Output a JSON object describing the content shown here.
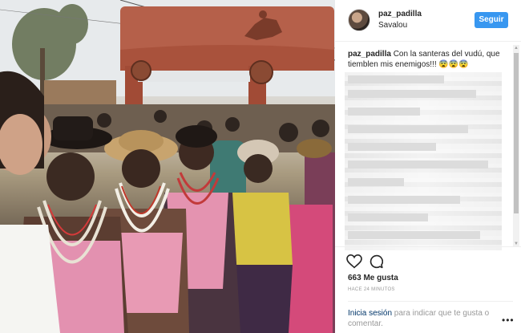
{
  "post": {
    "username": "paz_padilla",
    "location": "Savalou",
    "follow_label": "Seguir"
  },
  "caption": {
    "username": "paz_padilla",
    "text": "Con la santeras del vudú, que tiemblen mis enemigos!!! 😨😨😨"
  },
  "footer": {
    "likes": "663 Me gusta",
    "time": "HACE 24 MINUTOS",
    "login_link": "Inicia sesión",
    "login_rest": " para indicar que te gusta o comentar.",
    "more": "•••"
  },
  "icons": {
    "like": "heart-icon",
    "comment": "comment-bubble-icon",
    "more": "more-options-icon"
  },
  "colors": {
    "follow_button": "#3897f0",
    "link": "#003569",
    "muted": "#999999"
  }
}
